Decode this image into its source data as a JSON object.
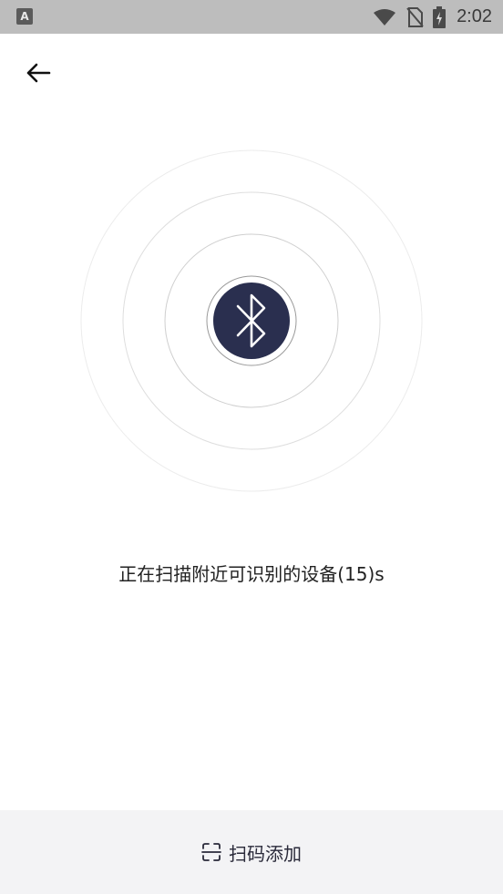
{
  "status_bar": {
    "app_icon_letter": "A",
    "time": "2:02",
    "icons": [
      "wifi-icon",
      "no-sim-icon",
      "battery-charging-icon"
    ]
  },
  "header": {
    "back_icon": "arrow-left-icon"
  },
  "scanner": {
    "center_icon": "bluetooth-icon",
    "center_color": "#2a2f4f",
    "status_text": "正在扫描附近可识别的设备(15)s"
  },
  "bottom": {
    "scan_icon": "scan-frame-icon",
    "label": "扫码添加"
  }
}
